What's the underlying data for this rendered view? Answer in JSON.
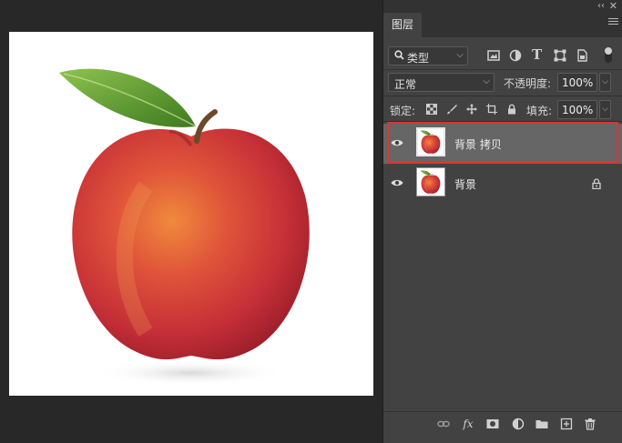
{
  "colors": {
    "workspace": "#282828",
    "panel": "#424242",
    "panel_dark": "#323232",
    "selected_row": "#666666",
    "annotation_red": "#e23232",
    "apple_red": "#c8323a",
    "leaf_green": "#5f9a2c"
  },
  "panel": {
    "top_controls": {
      "collapse": "‹‹",
      "close": "✕"
    },
    "tab": {
      "label": "图层"
    },
    "menu_icon": "panel-menu-icon",
    "filter": {
      "kind_label": "类型",
      "icons": [
        "image-filter-icon",
        "adjustment-filter-icon",
        "type-filter-icon",
        "shape-filter-icon",
        "smart-object-filter-icon"
      ],
      "type_glyph": "T"
    },
    "blend": {
      "mode": "正常",
      "opacity_label": "不透明度:",
      "opacity_value": "100%"
    },
    "lock": {
      "label": "锁定:",
      "icons": [
        "lock-transparent-pixels-icon",
        "lock-image-pixels-icon",
        "lock-position-icon",
        "lock-artboard-icon",
        "lock-all-icon"
      ],
      "fill_label": "填充:",
      "fill_value": "100%"
    },
    "layers": [
      {
        "name": "背景 拷贝",
        "visible": true,
        "selected": true,
        "locked": false
      },
      {
        "name": "背景",
        "visible": true,
        "selected": false,
        "locked": true
      }
    ],
    "footer_icons": [
      "link-layers-icon",
      "fx-icon",
      "layer-mask-icon",
      "adjustment-layer-icon",
      "group-folder-icon",
      "new-layer-icon",
      "trash-icon"
    ],
    "fx_label": "fx"
  }
}
